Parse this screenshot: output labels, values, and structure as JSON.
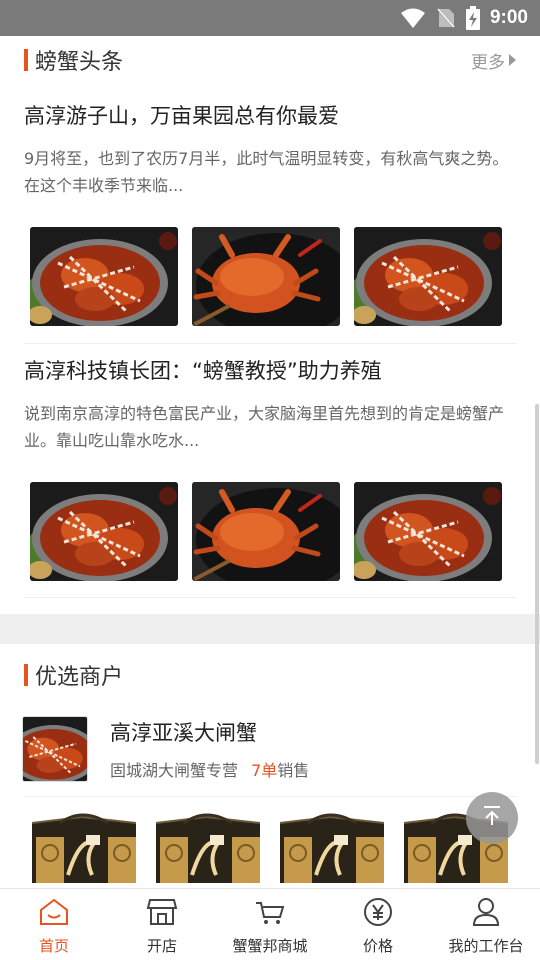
{
  "status_bar": {
    "time": "9:00"
  },
  "headlines": {
    "title": "螃蟹头条",
    "more": "更多",
    "articles": [
      {
        "title": "高淳游子山，万亩果园总有你最爱",
        "summary": "9月将至，也到了农历7月半，此时气温明显转变，有秋高气爽之势。在这个丰收季节来临..."
      },
      {
        "title": "高淳科技镇长团：“螃蟹教授”助力养殖",
        "summary": "说到南京高淳的特色富民产业，大家脑海里首先想到的肯定是螃蟹产业。靠山吃山靠水吃水..."
      }
    ]
  },
  "merchants": {
    "title": "优选商户",
    "items": [
      {
        "name": "高淳亚溪大闸蟹",
        "shop": "固城湖大闸蟹专营",
        "sales_count": "7单",
        "sales_suffix": "销售"
      }
    ]
  },
  "tabbar": {
    "items": [
      {
        "label": "首页",
        "icon": "home-icon",
        "active": true
      },
      {
        "label": "开店",
        "icon": "shop-icon",
        "active": false
      },
      {
        "label": "蟹蟹邦商城",
        "icon": "cart-icon",
        "active": false
      },
      {
        "label": "价格",
        "icon": "yuan-icon",
        "active": false
      },
      {
        "label": "我的工作台",
        "icon": "user-icon",
        "active": false
      }
    ]
  },
  "colors": {
    "accent": "#e8531f",
    "statusbar": "#7a7a7a",
    "band": "#efefef"
  }
}
